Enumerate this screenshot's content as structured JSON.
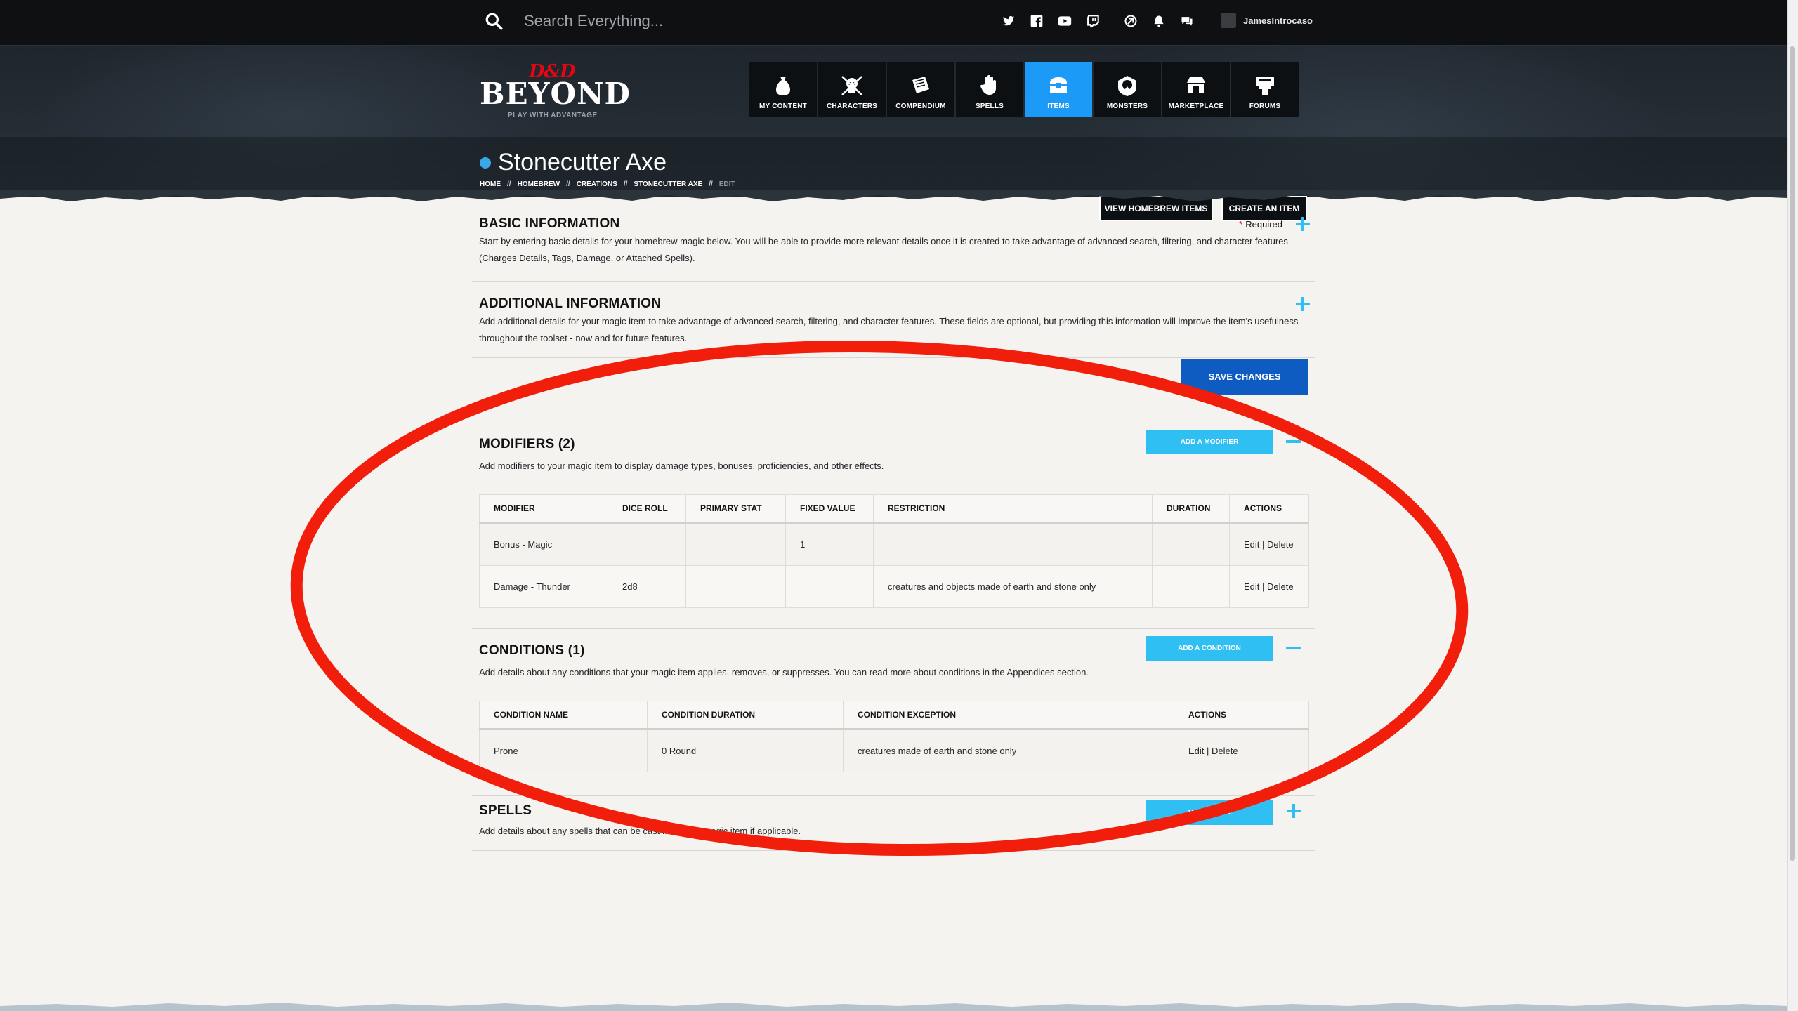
{
  "topbar": {
    "search_placeholder": "Search Everything...",
    "social_icons": [
      "twitter-icon",
      "facebook-icon",
      "youtube-icon",
      "twitch-icon"
    ],
    "utility_icons": [
      "dice-icon",
      "bell-icon",
      "chat-icon"
    ],
    "username": "JamesIntrocaso"
  },
  "logo": {
    "mark": "D&D",
    "name": "BEYOND",
    "tagline": "PLAY WITH ADVANTAGE"
  },
  "mainnav": [
    {
      "label": "MY CONTENT",
      "icon": "my-content-icon",
      "active": false
    },
    {
      "label": "CHARACTERS",
      "icon": "characters-icon",
      "active": false
    },
    {
      "label": "COMPENDIUM",
      "icon": "compendium-icon",
      "active": false
    },
    {
      "label": "SPELLS",
      "icon": "spells-icon",
      "active": false
    },
    {
      "label": "ITEMS",
      "icon": "items-icon",
      "active": true
    },
    {
      "label": "MONSTERS",
      "icon": "monsters-icon",
      "active": false
    },
    {
      "label": "MARKETPLACE",
      "icon": "marketplace-icon",
      "active": false
    },
    {
      "label": "FORUMS",
      "icon": "forums-icon",
      "active": false
    }
  ],
  "page": {
    "title": "Stonecutter Axe",
    "breadcrumb": [
      "HOME",
      "HOMEBREW",
      "CREATIONS",
      "STONECUTTER AXE",
      "EDIT"
    ],
    "breadcrumb_sep": "//",
    "view_homebrew_label": "VIEW HOMEBREW ITEMS",
    "create_item_label": "CREATE AN ITEM"
  },
  "basic": {
    "title": "BASIC INFORMATION",
    "required_star": "*",
    "required_label": "Required",
    "desc": "Start by entering basic details for your homebrew magic below. You will be able to provide more relevant details once it is created to take advantage of advanced search, filtering, and character features (Charges Details, Tags, Damage, or Attached Spells)."
  },
  "additional": {
    "title": "ADDITIONAL INFORMATION",
    "desc": "Add additional details for your magic item to take advantage of advanced search, filtering, and character features. These fields are optional, but providing this information will improve the item's usefulness throughout the toolset - now and for future features."
  },
  "save_label": "SAVE CHANGES",
  "modifiers": {
    "title": "MODIFIERS (2)",
    "add_label": "ADD A MODIFIER",
    "desc": "Add modifiers to your magic item to display damage types, bonuses, proficiencies, and other effects.",
    "headers": [
      "MODIFIER",
      "DICE ROLL",
      "PRIMARY STAT",
      "FIXED VALUE",
      "RESTRICTION",
      "DURATION",
      "ACTIONS"
    ],
    "rows": [
      [
        "Bonus - Magic",
        "",
        "",
        "1",
        "",
        "",
        ""
      ],
      [
        "Damage - Thunder",
        "2d8",
        "",
        "",
        "creatures and objects made of earth and stone only",
        "",
        ""
      ]
    ],
    "edit_label": "Edit",
    "delete_label": "Delete",
    "action_sep": "|"
  },
  "conditions": {
    "title": "CONDITIONS (1)",
    "add_label": "ADD A CONDITION",
    "desc": "Add details about any conditions that your magic item applies, removes, or suppresses. You can read more about conditions in the Appendices section.",
    "headers": [
      "CONDITION NAME",
      "CONDITION DURATION",
      "CONDITION EXCEPTION",
      "ACTIONS"
    ],
    "rows": [
      [
        "Prone",
        "0 Round",
        "creatures made of earth and stone only",
        ""
      ]
    ]
  },
  "spells": {
    "title": "SPELLS",
    "add_label": "ADD A SPELL",
    "desc": "Add details about any spells that can be cast from your magic item if applicable."
  },
  "colors": {
    "accent": "#1b9af7",
    "add_button": "#30bff2",
    "save_button": "#0e5bc2",
    "annotation": "#f21e0c",
    "required_star": "#e40712"
  }
}
